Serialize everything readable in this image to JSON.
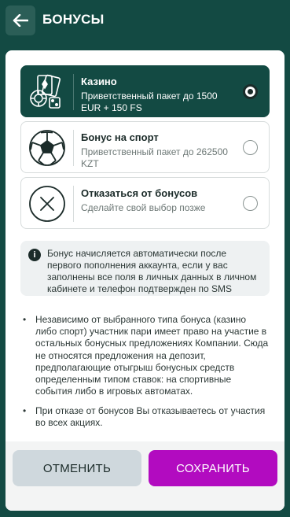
{
  "header": {
    "title": "БОНУСЫ",
    "back_icon": "arrow-left-icon"
  },
  "options": [
    {
      "title": "Казино",
      "desc": "Приветственный пакет до 1500 EUR + 150 FS",
      "icon": "casino-cards-chips-icon",
      "selected": true
    },
    {
      "title": "Бонус на спорт",
      "desc": "Приветственный пакет до 262500 KZT",
      "icon": "soccer-ball-icon",
      "selected": false
    },
    {
      "title": "Отказаться от бонусов",
      "desc": "Сделайте свой выбор позже",
      "icon": "close-circle-icon",
      "selected": false
    }
  ],
  "info": {
    "icon": "info-icon",
    "glyph": "i",
    "text": "Бонус начисляется автоматически после первого пополнения аккаунта, если у вас заполнены все поля в личных данных в личном кабинете и телефон подтвержден по SMS"
  },
  "notes": [
    {
      "bullet": "•",
      "text": "Независимо от выбранного типа бонуса (казино либо спорт) участник пари имеет право на участие в остальных бонусных предложениях Компании. Сюда не относятся предложения на депозит, предполагающие отыгрыш бонусных средств определенным типом ставок: на спортивные события либо в игровых автоматах."
    },
    {
      "bullet": "•",
      "text": "При отказе от бонусов Вы отказываетесь от участия во всех акциях."
    }
  ],
  "footer": {
    "cancel_label": "ОТМЕНИТЬ",
    "save_label": "СОХРАНИТЬ"
  },
  "colors": {
    "header_bg": "#134a43",
    "selected_bg": "#134a43",
    "save_bg": "#b20bc0",
    "cancel_bg": "#cfd8dd"
  }
}
